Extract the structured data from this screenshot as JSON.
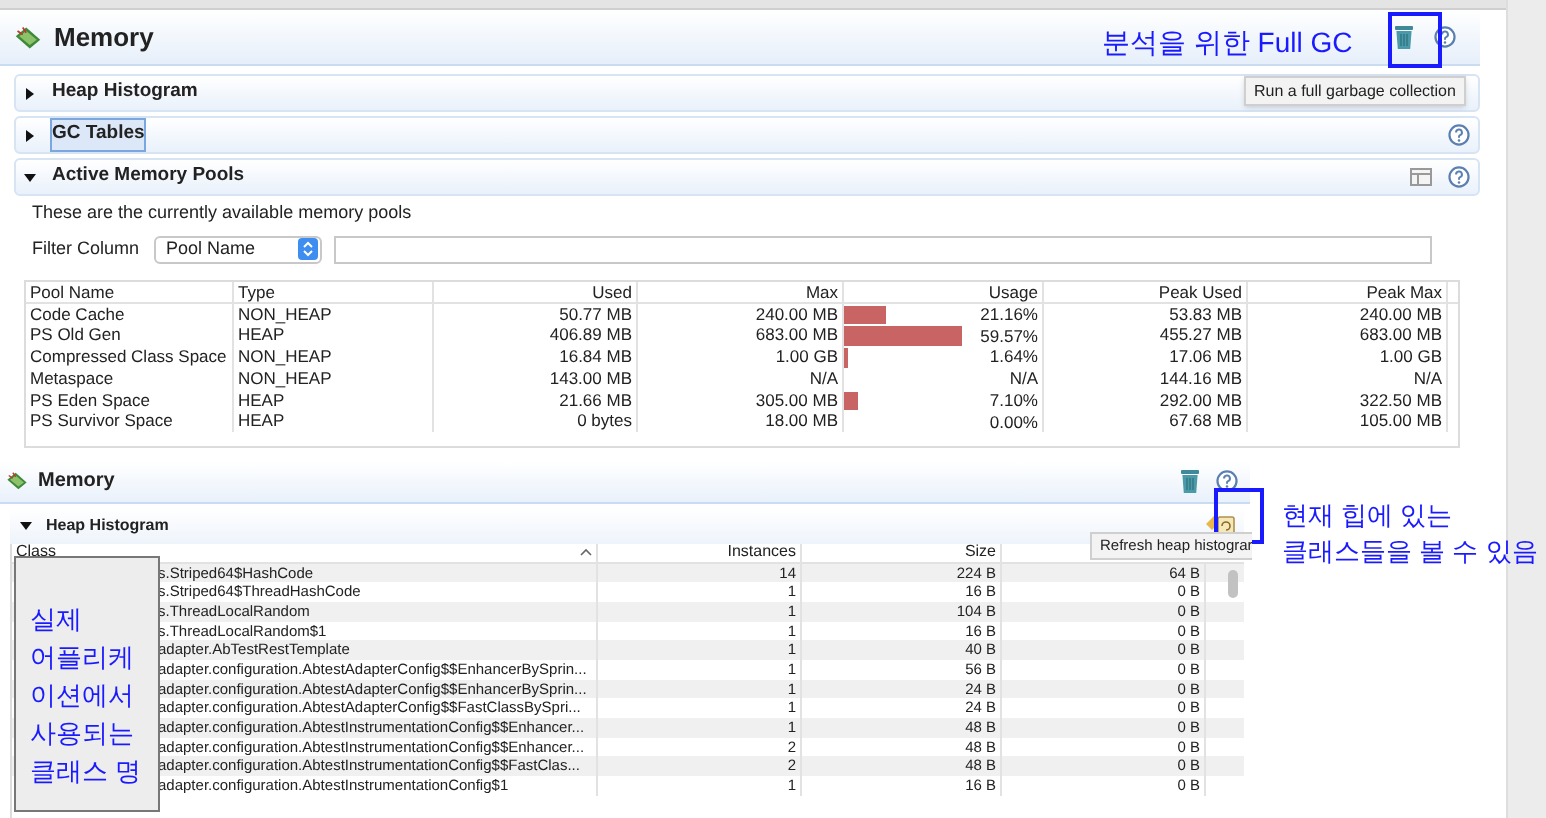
{
  "top_panel": {
    "title": "Memory",
    "annotation": "분석을 위한 Full GC",
    "tooltip": "Run a full garbage collection",
    "sections": [
      {
        "title": "Heap Histogram",
        "expanded": false,
        "focused": false
      },
      {
        "title": "GC Tables",
        "expanded": false,
        "focused": true
      },
      {
        "title": "Active Memory Pools",
        "expanded": true,
        "focused": false
      }
    ],
    "description": "These are the currently available memory pools",
    "filter": {
      "label": "Filter Column",
      "value": "Pool Name"
    },
    "pools_table": {
      "columns": [
        "Pool Name",
        "Type",
        "Used",
        "Max",
        "Usage",
        "Peak Used",
        "Peak Max"
      ],
      "rows": [
        {
          "cells": [
            "Code Cache",
            "NON_HEAP",
            "50.77 MB",
            "240.00 MB",
            "21.16%",
            "53.83 MB",
            "240.00 MB"
          ],
          "level": 0.2116
        },
        {
          "cells": [
            "PS Old Gen",
            "HEAP",
            "406.89 MB",
            "683.00 MB",
            "59.57%",
            "455.27 MB",
            "683.00 MB"
          ],
          "level": 0.5957
        },
        {
          "cells": [
            "Compressed Class Space",
            "NON_HEAP",
            "16.84 MB",
            "1.00 GB",
            "1.64%",
            "17.06 MB",
            "1.00 GB"
          ],
          "level": 0.0164
        },
        {
          "cells": [
            "Metaspace",
            "NON_HEAP",
            "143.00 MB",
            "N/A",
            "N/A",
            "144.16 MB",
            "N/A"
          ]
        },
        {
          "cells": [
            "PS Eden Space",
            "HEAP",
            "21.66 MB",
            "305.00 MB",
            "7.10%",
            "292.00 MB",
            "322.50 MB"
          ],
          "level": 0.071
        },
        {
          "cells": [
            "PS Survivor Space",
            "HEAP",
            "0 bytes",
            "18.00 MB",
            "0.00%",
            "67.68 MB",
            "105.00 MB"
          ]
        }
      ]
    }
  },
  "bottom_panel": {
    "title": "Memory",
    "section": {
      "title": "Heap Histogram",
      "expanded": true
    },
    "tooltip": "Refresh heap histograr",
    "annotation_lines": [
      "현재 힙에 있는",
      "클래스들을 볼 수 있음"
    ],
    "note_lines": [
      "실제",
      "어플리케",
      "이션에서",
      "사용되는",
      "클래스 명"
    ],
    "histogram_table": {
      "columns": [
        "Class",
        "Instances",
        "Size"
      ],
      "rows": [
        [
          "s.Striped64$HashCode",
          "14",
          "224 B",
          "64 B"
        ],
        [
          "s.Striped64$ThreadHashCode",
          "1",
          "16 B",
          "0 B"
        ],
        [
          "s.ThreadLocalRandom",
          "1",
          "104 B",
          "0 B"
        ],
        [
          "s.ThreadLocalRandom$1",
          "1",
          "16 B",
          "0 B"
        ],
        [
          "adapter.AbTestRestTemplate",
          "1",
          "40 B",
          "0 B"
        ],
        [
          "adapter.configuration.AbtestAdapterConfig$$EnhancerBySprin...",
          "1",
          "56 B",
          "0 B"
        ],
        [
          "adapter.configuration.AbtestAdapterConfig$$EnhancerBySprin...",
          "1",
          "24 B",
          "0 B"
        ],
        [
          "adapter.configuration.AbtestAdapterConfig$$FastClassBySpri...",
          "1",
          "24 B",
          "0 B"
        ],
        [
          "adapter.configuration.AbtestInstrumentationConfig$$Enhancer...",
          "1",
          "48 B",
          "0 B"
        ],
        [
          "adapter.configuration.AbtestInstrumentationConfig$$Enhancer...",
          "2",
          "48 B",
          "0 B"
        ],
        [
          "adapter.configuration.AbtestInstrumentationConfig$$FastClas...",
          "2",
          "48 B",
          "0 B"
        ],
        [
          "adapter.configuration.AbtestInstrumentationConfig$1",
          "1",
          "16 B",
          "0 B"
        ]
      ]
    }
  }
}
